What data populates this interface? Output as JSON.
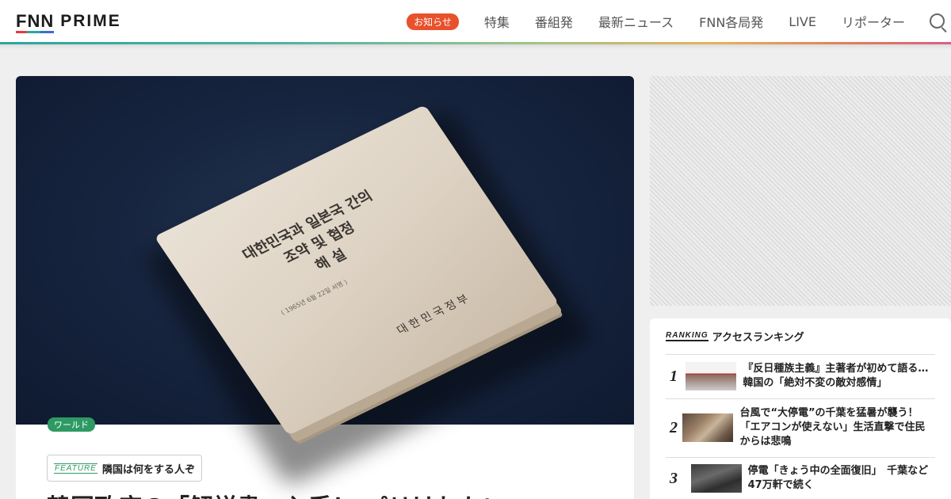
{
  "header": {
    "logo_fnn": "FNN",
    "logo_prime": "PRIME",
    "notice_label": "お知らせ",
    "nav": [
      "特集",
      "番組発",
      "最新ニュース",
      "FNN各局発",
      "LIVE",
      "リポーター"
    ],
    "colors": {
      "notice": "#e8512b",
      "logo_bars": [
        "#e83b3b",
        "#2aa6a0",
        "#3a6fd1"
      ]
    }
  },
  "hero": {
    "category": "ワールド",
    "book_title": "대한민국과 일본국 간의\n조약 및 협정\n해 설",
    "book_subtitle": "( 1965년 6월 22일 서명 )",
    "book_publisher": "대한민국정부"
  },
  "feature": {
    "label": "FEATURE",
    "name": "隣国は何をする人ぞ"
  },
  "article": {
    "title": "韓国政府の「解説書」入手！ パリけわかい"
  },
  "ranking": {
    "label": "RANKING",
    "title": "アクセスランキング",
    "items": [
      {
        "rank": "1",
        "text": "『反日種族主義』主著者が初めて語る…韓国の「絶対不変の敵対感情」"
      },
      {
        "rank": "2",
        "text": "台風で“大停電”の千葉を猛暑が襲う！「エアコンが使えない」生活直撃で住民からは悲鳴"
      },
      {
        "rank": "3",
        "text": "停電「きょう中の全面復旧」　千葉など47万軒で続く"
      }
    ]
  },
  "colors": {
    "accent_green": "#2e9a63",
    "navy_background": "#172540"
  }
}
